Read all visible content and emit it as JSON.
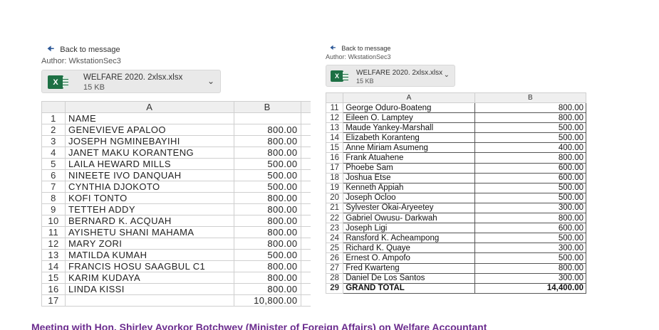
{
  "left": {
    "back_label": "Back to message",
    "author": "Author:   WkstationSec3",
    "attachment": {
      "name": "WELFARE 2020. 2xlsx.xlsx",
      "size": "15 KB"
    },
    "icon": "excel-file-icon",
    "columns": [
      "A",
      "B"
    ],
    "rows": [
      {
        "n": "1",
        "a": "NAME",
        "b": ""
      },
      {
        "n": "2",
        "a": "GENEVIEVE APALOO",
        "b": "800.00"
      },
      {
        "n": "3",
        "a": "JOSEPH NGMINEBAYIHI",
        "b": "800.00"
      },
      {
        "n": "4",
        "a": "JANET MAKU KORANTENG",
        "b": "800.00"
      },
      {
        "n": "5",
        "a": "LAILA HEWARD MILLS",
        "b": "500.00"
      },
      {
        "n": "6",
        "a": "NINEETE IVO DANQUAH",
        "b": "500.00"
      },
      {
        "n": "7",
        "a": "CYNTHIA DJOKOTO",
        "b": "500.00"
      },
      {
        "n": "8",
        "a": "KOFI TONTO",
        "b": "800.00"
      },
      {
        "n": "9",
        "a": "TETTEH ADDY",
        "b": "800.00"
      },
      {
        "n": "10",
        "a": "BERNARD K. ACQUAH",
        "b": "800.00"
      },
      {
        "n": "11",
        "a": "AYISHETU SHANI MAHAMA",
        "b": "800.00"
      },
      {
        "n": "12",
        "a": "MARY ZORI",
        "b": "800.00"
      },
      {
        "n": "13",
        "a": "MATILDA KUMAH",
        "b": "500.00"
      },
      {
        "n": "14",
        "a": "FRANCIS HOSU SAAGBUL  C1",
        "b": "800.00"
      },
      {
        "n": "15",
        "a": "KARIM KUDAYA",
        "b": "800.00"
      },
      {
        "n": "16",
        "a": "LINDA KISSI",
        "b": "800.00"
      },
      {
        "n": "17",
        "a": "",
        "b": "10,800.00"
      }
    ]
  },
  "right": {
    "back_label": "Back to message",
    "author": "Author:   WkstationSec3",
    "attachment": {
      "name": "WELFARE 2020. 2xlsx.xlsx",
      "size": "15 KB"
    },
    "icon": "excel-file-icon",
    "columns": [
      "A",
      "B"
    ],
    "rows": [
      {
        "n": "11",
        "a": "George Oduro-Boateng",
        "b": "800.00"
      },
      {
        "n": "12",
        "a": "Eileen O. Lamptey",
        "b": "800.00"
      },
      {
        "n": "13",
        "a": "Maude Yankey-Marshall",
        "b": "500.00"
      },
      {
        "n": "14",
        "a": "Elizabeth Koranteng",
        "b": "500.00"
      },
      {
        "n": "15",
        "a": "Anne Miriam Asumeng",
        "b": "400.00"
      },
      {
        "n": "16",
        "a": "Frank Atuahene",
        "b": "800.00"
      },
      {
        "n": "17",
        "a": "Phoebe Sam",
        "b": "600.00"
      },
      {
        "n": "18",
        "a": "Joshua Etse",
        "b": "600.00"
      },
      {
        "n": "19",
        "a": "Kenneth Appiah",
        "b": "500.00"
      },
      {
        "n": "20",
        "a": "Joseph Ocloo",
        "b": "500.00"
      },
      {
        "n": "21",
        "a": "Sylvester Okai-Aryeetey",
        "b": "300.00"
      },
      {
        "n": "22",
        "a": "Gabriel Owusu- Darkwah",
        "b": "800.00"
      },
      {
        "n": "23",
        "a": "Joseph Ligi",
        "b": "600.00"
      },
      {
        "n": "24",
        "a": "Ransford K. Acheampong",
        "b": "500.00"
      },
      {
        "n": "25",
        "a": "Richard K. Quaye",
        "b": "300.00"
      },
      {
        "n": "26",
        "a": "Ernest O. Ampofo",
        "b": "500.00"
      },
      {
        "n": "27",
        "a": "Fred Kwarteng",
        "b": "800.00"
      },
      {
        "n": "28",
        "a": "Daniel De Los Santos",
        "b": "300.00"
      },
      {
        "n": "29",
        "a": "GRAND TOTAL",
        "b": "14,400.00"
      }
    ]
  },
  "caption": "Meeting with Hon. Shirley Ayorkor Botchwey (Minister of Foreign Affairs) on Welfare Accountant"
}
